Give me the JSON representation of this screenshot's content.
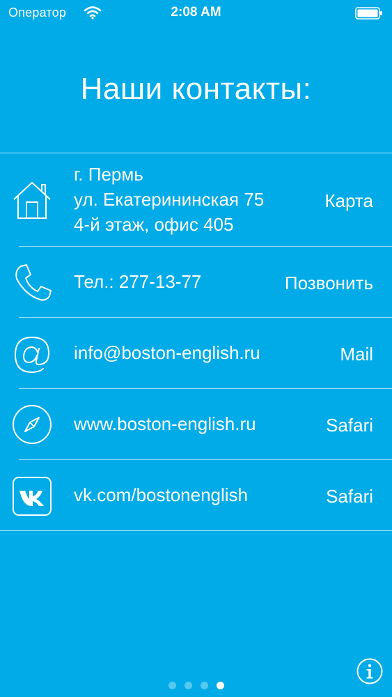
{
  "status_bar": {
    "carrier": "Оператор",
    "time": "2:08 AM"
  },
  "header": {
    "title": "Наши контакты:"
  },
  "contacts": [
    {
      "icon": "house-icon",
      "lines": [
        "г. Пермь",
        "ул. Екатерининская 75",
        "4-й этаж, офис 405"
      ],
      "action": "Карта"
    },
    {
      "icon": "phone-icon",
      "lines": [
        "Тел.: 277-13-77"
      ],
      "action": "Позвонить"
    },
    {
      "icon": "at-sign-icon",
      "lines": [
        "info@boston-english.ru"
      ],
      "action": "Mail"
    },
    {
      "icon": "compass-icon",
      "lines": [
        "www.boston-english.ru"
      ],
      "action": "Safari"
    },
    {
      "icon": "vk-icon",
      "lines": [
        "vk.com/bostonenglish"
      ],
      "action": "Safari"
    }
  ],
  "pager": {
    "total": 4,
    "current": 4
  },
  "colors": {
    "background": "#00abe7",
    "foreground": "#ffffff"
  }
}
